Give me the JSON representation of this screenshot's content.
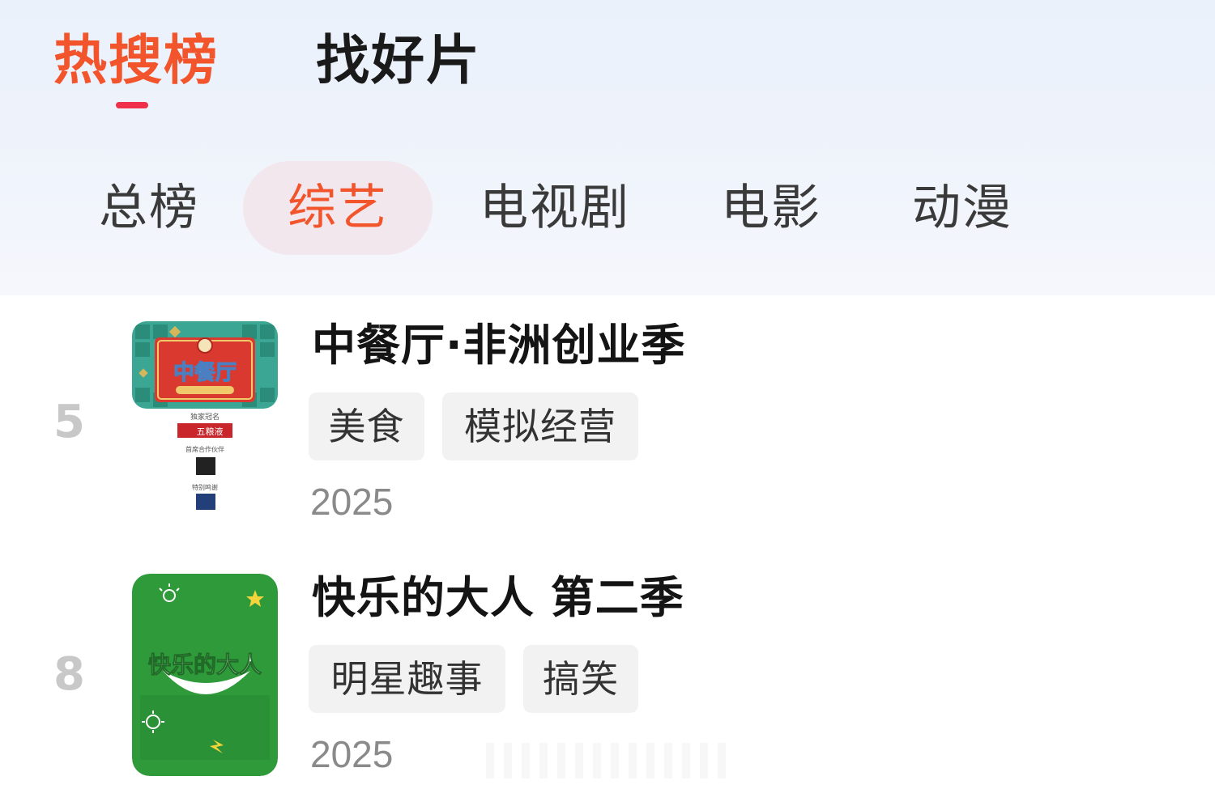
{
  "main_tabs": [
    {
      "label": "热搜榜",
      "active": true
    },
    {
      "label": "找好片",
      "active": false
    }
  ],
  "category_tabs": [
    {
      "label": "总榜",
      "active": false
    },
    {
      "label": "综艺",
      "active": true
    },
    {
      "label": "电视剧",
      "active": false
    },
    {
      "label": "电影",
      "active": false
    },
    {
      "label": "动漫",
      "active": false
    }
  ],
  "items": [
    {
      "rank": "5",
      "title": "中餐厅·非洲创业季",
      "tags": [
        "美食",
        "模拟经营"
      ],
      "year": "2025",
      "poster": {
        "logo_text": "中餐厅",
        "credits": [
          "独家冠名",
          "五粮液",
          "首席合作伙伴",
          "特别鸣谢"
        ]
      }
    },
    {
      "rank": "8",
      "title": "快乐的大人 第二季",
      "tags": [
        "明星趣事",
        "搞笑"
      ],
      "year": "2025",
      "poster": {
        "logo_text": "快乐的大人"
      }
    }
  ],
  "colors": {
    "accent": "#f2552c",
    "underline": "#f0304a",
    "active_pill": "#f3e7ee",
    "tag_bg": "#f2f2f2",
    "rank": "#c8c8c8",
    "poster_green": "#2f9a3a",
    "poster_red": "#d9392f",
    "poster_teal": "#3aa693"
  }
}
